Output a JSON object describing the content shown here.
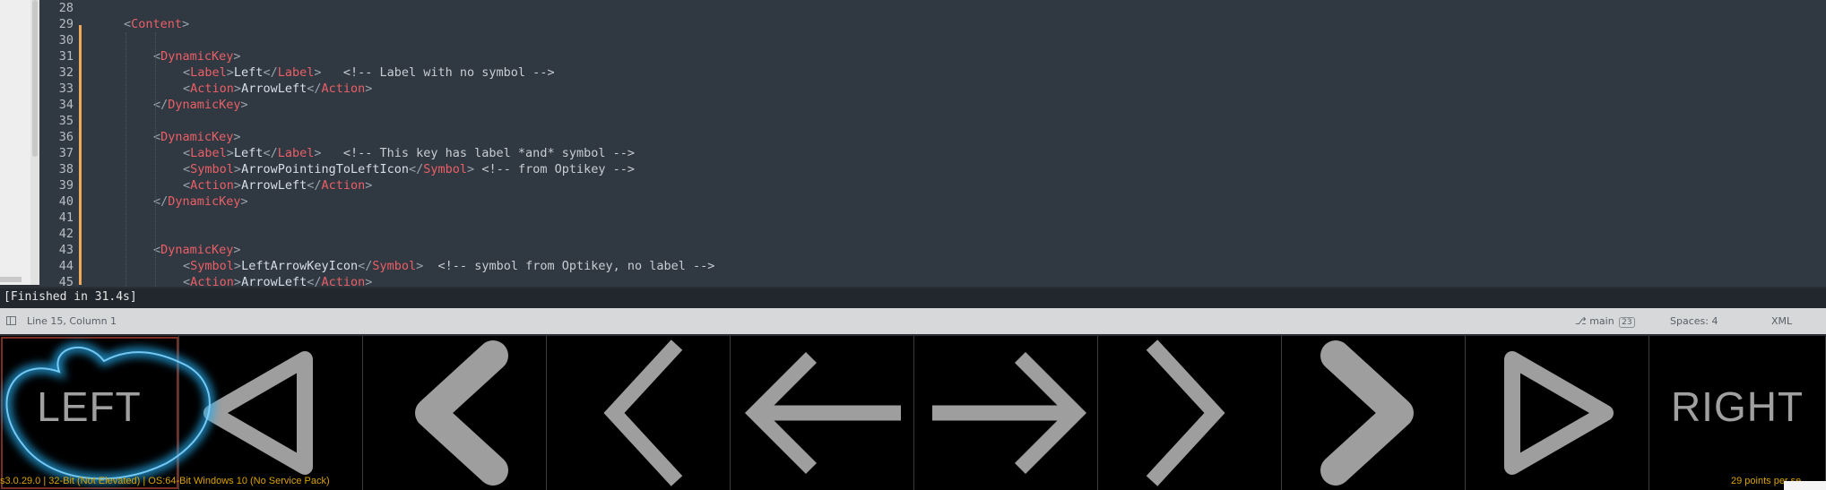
{
  "editor": {
    "lines": [
      {
        "n": "28",
        "indent": 0,
        "parts": []
      },
      {
        "n": "29",
        "indent": 1,
        "parts": [
          [
            "br",
            "<"
          ],
          [
            "tag",
            "Content"
          ],
          [
            "br",
            ">"
          ]
        ]
      },
      {
        "n": "30",
        "indent": 0,
        "parts": []
      },
      {
        "n": "31",
        "indent": 2,
        "parts": [
          [
            "br",
            "<"
          ],
          [
            "tag",
            "DynamicKey"
          ],
          [
            "br",
            ">"
          ]
        ]
      },
      {
        "n": "32",
        "indent": 3,
        "parts": [
          [
            "br",
            "<"
          ],
          [
            "tag",
            "Label"
          ],
          [
            "br",
            ">"
          ],
          [
            "txt",
            "Left"
          ],
          [
            "br",
            "</"
          ],
          [
            "tag",
            "Label"
          ],
          [
            "br",
            ">"
          ],
          [
            "cmt",
            "   <!-- Label with no symbol -->"
          ]
        ]
      },
      {
        "n": "33",
        "indent": 3,
        "parts": [
          [
            "br",
            "<"
          ],
          [
            "tag",
            "Action"
          ],
          [
            "br",
            ">"
          ],
          [
            "txt",
            "ArrowLeft"
          ],
          [
            "br",
            "</"
          ],
          [
            "tag",
            "Action"
          ],
          [
            "br",
            ">"
          ]
        ]
      },
      {
        "n": "34",
        "indent": 2,
        "parts": [
          [
            "br",
            "</"
          ],
          [
            "tag",
            "DynamicKey"
          ],
          [
            "br",
            ">"
          ]
        ]
      },
      {
        "n": "35",
        "indent": 0,
        "parts": []
      },
      {
        "n": "36",
        "indent": 2,
        "parts": [
          [
            "br",
            "<"
          ],
          [
            "tag",
            "DynamicKey"
          ],
          [
            "br",
            ">"
          ]
        ]
      },
      {
        "n": "37",
        "indent": 3,
        "parts": [
          [
            "br",
            "<"
          ],
          [
            "tag",
            "Label"
          ],
          [
            "br",
            ">"
          ],
          [
            "txt",
            "Left"
          ],
          [
            "br",
            "</"
          ],
          [
            "tag",
            "Label"
          ],
          [
            "br",
            ">"
          ],
          [
            "cmt",
            "   <!-- This key has label *and* symbol -->"
          ]
        ]
      },
      {
        "n": "38",
        "indent": 3,
        "parts": [
          [
            "br",
            "<"
          ],
          [
            "tag",
            "Symbol"
          ],
          [
            "br",
            ">"
          ],
          [
            "txt",
            "ArrowPointingToLeftIcon"
          ],
          [
            "br",
            "</"
          ],
          [
            "tag",
            "Symbol"
          ],
          [
            "br",
            ">"
          ],
          [
            "cmt",
            " <!-- from Optikey -->"
          ]
        ]
      },
      {
        "n": "39",
        "indent": 3,
        "parts": [
          [
            "br",
            "<"
          ],
          [
            "tag",
            "Action"
          ],
          [
            "br",
            ">"
          ],
          [
            "txt",
            "ArrowLeft"
          ],
          [
            "br",
            "</"
          ],
          [
            "tag",
            "Action"
          ],
          [
            "br",
            ">"
          ]
        ]
      },
      {
        "n": "40",
        "indent": 2,
        "parts": [
          [
            "br",
            "</"
          ],
          [
            "tag",
            "DynamicKey"
          ],
          [
            "br",
            ">"
          ]
        ]
      },
      {
        "n": "41",
        "indent": 0,
        "parts": []
      },
      {
        "n": "42",
        "indent": 0,
        "parts": []
      },
      {
        "n": "43",
        "indent": 2,
        "parts": [
          [
            "br",
            "<"
          ],
          [
            "tag",
            "DynamicKey"
          ],
          [
            "br",
            ">"
          ]
        ]
      },
      {
        "n": "44",
        "indent": 3,
        "parts": [
          [
            "br",
            "<"
          ],
          [
            "tag",
            "Symbol"
          ],
          [
            "br",
            ">"
          ],
          [
            "txt",
            "LeftArrowKeyIcon"
          ],
          [
            "br",
            "</"
          ],
          [
            "tag",
            "Symbol"
          ],
          [
            "br",
            ">"
          ],
          [
            "cmt",
            "  <!-- symbol from Optikey, no label -->"
          ]
        ]
      },
      {
        "n": "45",
        "indent": 3,
        "parts": [
          [
            "br",
            "<"
          ],
          [
            "tag",
            "Action"
          ],
          [
            "br",
            ">"
          ],
          [
            "txt",
            "ArrowLeft"
          ],
          [
            "br",
            "</"
          ],
          [
            "tag",
            "Action"
          ],
          [
            "br",
            ">"
          ]
        ]
      }
    ]
  },
  "output": {
    "text": "[Finished in 31.4s]"
  },
  "statusbar": {
    "position": "Line 15, Column 1",
    "branch": "main",
    "branch_badge": "23",
    "spaces": "Spaces: 4",
    "syntax": "XML"
  },
  "keyboard": {
    "keys": [
      {
        "label": "LEFT",
        "icon": "text-label",
        "selected": true
      },
      {
        "label": "",
        "icon": "triangle-left-outline-icon"
      },
      {
        "label": "",
        "icon": "chevron-left-bold-icon"
      },
      {
        "label": "",
        "icon": "chevron-left-thin-icon"
      },
      {
        "label": "",
        "icon": "arrow-left-icon"
      },
      {
        "label": "",
        "icon": "arrow-right-icon"
      },
      {
        "label": "",
        "icon": "chevron-right-thin-icon"
      },
      {
        "label": "",
        "icon": "chevron-right-bold-icon"
      },
      {
        "label": "",
        "icon": "triangle-right-outline-icon"
      },
      {
        "label": "RIGHT",
        "icon": "text-label"
      }
    ],
    "info_left": "s3.0.29.0 | 32-Bit (Not Elevated) | OS:64-Bit Windows 10 (No Service Pack)",
    "info_right": "29 points per se",
    "colors": {
      "key_symbol": "#9e9e9e",
      "glow": "#27a8e8",
      "selection": "#7a2f22",
      "info": "#d9a100"
    }
  }
}
